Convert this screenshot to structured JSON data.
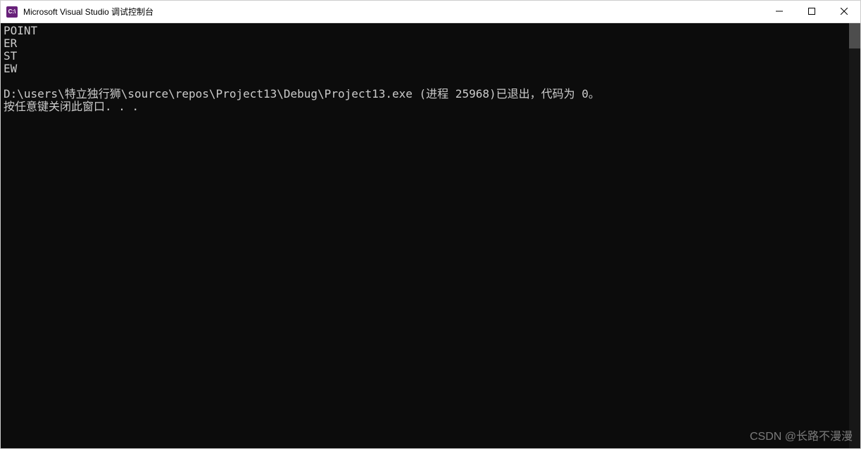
{
  "titlebar": {
    "icon_text": "C:\\",
    "title": "Microsoft Visual Studio 调试控制台"
  },
  "console": {
    "lines": [
      "POINT",
      "ER",
      "ST",
      "EW",
      "",
      "D:\\users\\特立独行狮\\source\\repos\\Project13\\Debug\\Project13.exe (进程 25968)已退出，代码为 0。",
      "按任意键关闭此窗口. . ."
    ]
  },
  "watermark": "CSDN @长路不漫漫"
}
